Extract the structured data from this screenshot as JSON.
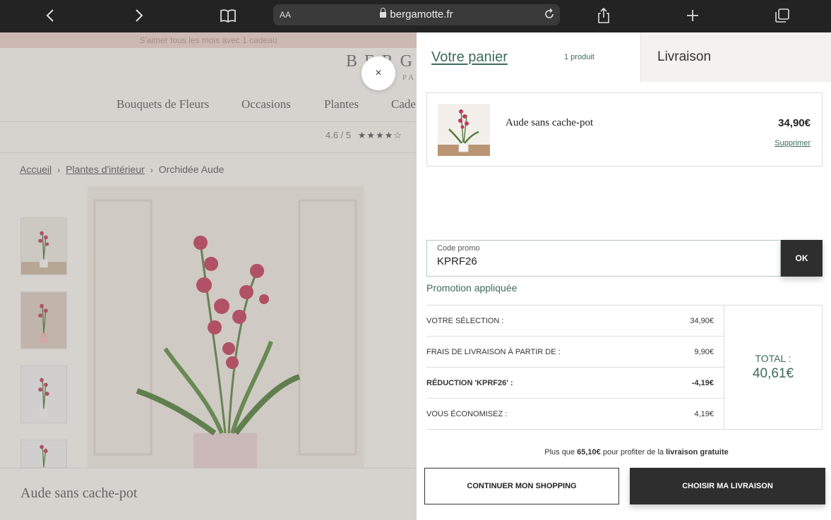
{
  "browser": {
    "text_size": "AA",
    "url": "bergamotte.fr",
    "icons": [
      "back-icon",
      "forward-icon",
      "bookmarks-icon",
      "lock-icon",
      "reload-icon",
      "share-icon",
      "new-tab-icon",
      "tabs-icon"
    ]
  },
  "site": {
    "promo_strip": "S'aimer tous les mois avec 1 cadeau",
    "brand": "BERGA",
    "brand_sub": "PA",
    "nav": [
      "Bouquets de Fleurs",
      "Occasions",
      "Plantes",
      "Cade"
    ],
    "rating": "4.6 / 5",
    "rating_stars": "★★★★☆",
    "breadcrumb": [
      "Accueil",
      "Plantes d'intérieur",
      "Orchidée Aude"
    ],
    "breadcrumb_sep": "›",
    "product_title": "Aude sans cache-pot",
    "close_label": "×"
  },
  "cart": {
    "title": "Votre panier",
    "count": "1 produit",
    "shipping_tab": "Livraison",
    "item": {
      "name": "Aude sans cache-pot",
      "price": "34,90€",
      "remove": "Supprimer"
    },
    "promo": {
      "label": "Code promo",
      "value": "KPRF26",
      "ok": "OK",
      "status": "Promotion appliquée"
    },
    "summary": [
      {
        "label": "VOTRE SÉLECTION :",
        "value": "34,90€",
        "bold": false
      },
      {
        "label": "FRAIS DE LIVRAISON À PARTIR DE :",
        "value": "9,90€",
        "bold": false
      },
      {
        "label": "RÉDUCTION 'KPRF26' :",
        "value": "-4,19€",
        "bold": true
      },
      {
        "label": "VOUS ÉCONOMISEZ :",
        "value": "4,19€",
        "bold": false
      }
    ],
    "total_label": "TOTAL :",
    "total_value": "40,61€",
    "free_shipping": {
      "prefix": "Plus que",
      "amount": "65,10€",
      "middle": "pour profiter de la",
      "highlight": "livraison gratuite"
    },
    "continue_button": "CONTINUER MON SHOPPING",
    "choose_button": "CHOISIR MA LIVRAISON"
  },
  "colors": {
    "accent_green": "#3d6b5a",
    "dark_button": "#2e2e2e",
    "browser_bar": "#232323"
  }
}
